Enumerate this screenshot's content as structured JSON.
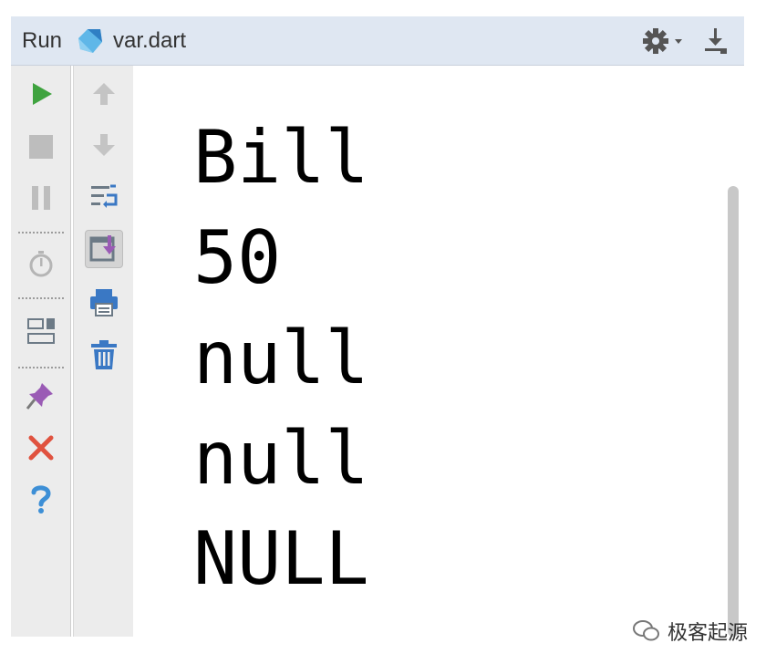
{
  "header": {
    "run_label": "Run",
    "file_name": "var.dart",
    "icons": [
      "dart-file-icon",
      "gear-icon",
      "chevron-down-icon",
      "download-icon"
    ]
  },
  "toolbar_primary": {
    "items": [
      "run-icon",
      "stop-icon",
      "pause-icon",
      "timer-icon",
      "layout-icon",
      "pin-icon",
      "close-icon",
      "help-icon"
    ]
  },
  "toolbar_secondary": {
    "items": [
      "arrow-up-icon",
      "arrow-down-icon",
      "soft-wrap-icon",
      "scroll-to-end-icon",
      "print-icon",
      "trash-icon"
    ]
  },
  "console": {
    "lines": [
      "Bill",
      "50",
      "null",
      "null",
      "NULL"
    ]
  },
  "colors": {
    "header_bg": "#dfe7f2",
    "toolbar_bg": "#ececec",
    "run_green": "#3fa33f",
    "close_red": "#e0523f",
    "help_blue": "#3d8fd6",
    "accent_blue": "#3a78c4",
    "pin_purple": "#9a5bb5"
  },
  "watermark": {
    "text": "极客起源"
  }
}
